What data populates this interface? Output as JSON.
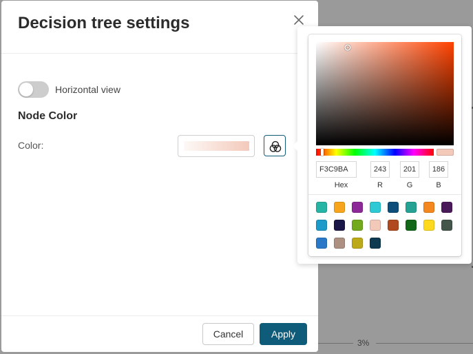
{
  "background": {
    "percent_label": "3%"
  },
  "dialog": {
    "title": "Decision tree settings",
    "close_icon": "close-icon",
    "horizontal_view": {
      "label": "Horizontal view",
      "enabled": false
    },
    "node_color": {
      "section_title": "Node Color",
      "color_label": "Color:",
      "value": "#F3C9BA",
      "picker_icon": "color-wheel-icon"
    },
    "footer": {
      "cancel_label": "Cancel",
      "apply_label": "Apply"
    },
    "colors": {
      "accent": "#0e5b7a"
    }
  },
  "color_picker": {
    "hex": "F3C9BA",
    "r": "243",
    "g": "201",
    "b": "186",
    "labels": {
      "hex": "Hex",
      "r": "R",
      "g": "G",
      "b": "B"
    },
    "hue_color": "#ff4200",
    "hue_fraction": 0.04,
    "saturation_fraction": 0.23,
    "brightness_fraction": 0.95,
    "presets": [
      "#26B5A5",
      "#F7A51D",
      "#8D2899",
      "#2DCAD6",
      "#0E4E7A",
      "#24A394",
      "#F5871F",
      "#491A5A",
      "#1C9BCA",
      "#1A1647",
      "#73A91C",
      "#F3C9BA",
      "#B04A1E",
      "#116618",
      "#FFD91E",
      "#445549",
      "#2A79C8",
      "#AC9082",
      "#BDAA1A",
      "#0D3A50"
    ]
  }
}
